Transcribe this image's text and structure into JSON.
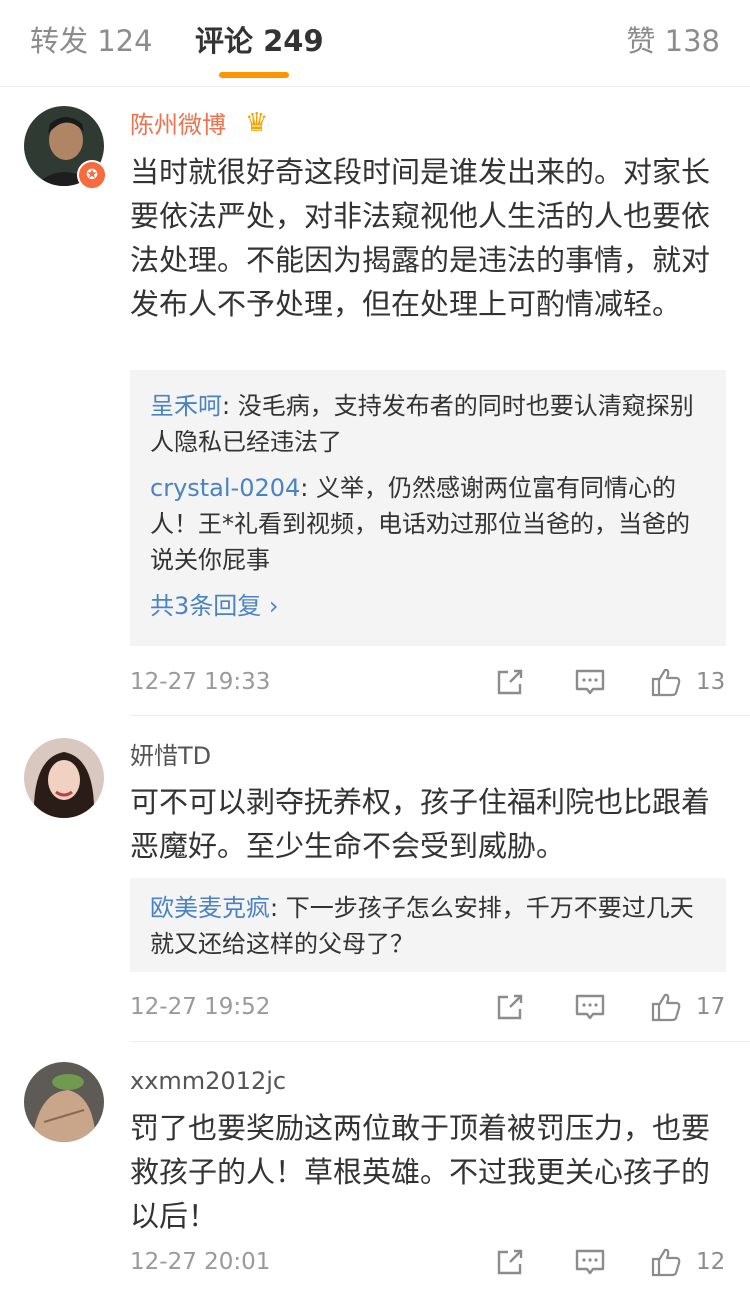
{
  "tabs": {
    "repost": "转发 124",
    "comments": "评论 249",
    "likes": "赞 138"
  },
  "colors": {
    "accent": "#ff9500",
    "vip_name": "#eb7350",
    "reply_user": "#4a83c4"
  },
  "comments": [
    {
      "user": "陈州微博",
      "crown_icon": "vip-crown-icon",
      "text": "当时就很好奇这段时间是谁发出来的。对家长要依法严处，对非法窥视他人生活的人也要依法处理。不能因为揭露的是违法的事情，就对发布人不予处理，但在处理上可酌情减轻。",
      "replies": [
        {
          "user": "呈禾呵",
          "text": ": 没毛病，支持发布者的同时也要认清窥探别人隐私已经违法了"
        },
        {
          "user": "crystal-0204",
          "text": ": 义举，仍然感谢两位富有同情心的人！王*礼看到视频，电话劝过那位当爸的，当爸的说关你屁事"
        }
      ],
      "more_replies": "共3条回复 ›",
      "time": "12-27 19:33",
      "likes": "13"
    },
    {
      "user": "妍惜TD",
      "text": "可不可以剥夺抚养权，孩子住福利院也比跟着恶魔好。至少生命不会受到威胁。",
      "replies": [
        {
          "user": "欧美麦克疯",
          "text": ": 下一步孩子怎么安排，千万不要过几天就又还给这样的父母了？"
        }
      ],
      "time": "12-27 19:52",
      "likes": "17"
    },
    {
      "user": "xxmm2012jc",
      "text": "罚了也要奖励这两位敢于顶着被罚压力，也要救孩子的人！草根英雄。不过我更关心孩子的以后！",
      "time": "12-27 20:01",
      "likes": "12"
    }
  ]
}
